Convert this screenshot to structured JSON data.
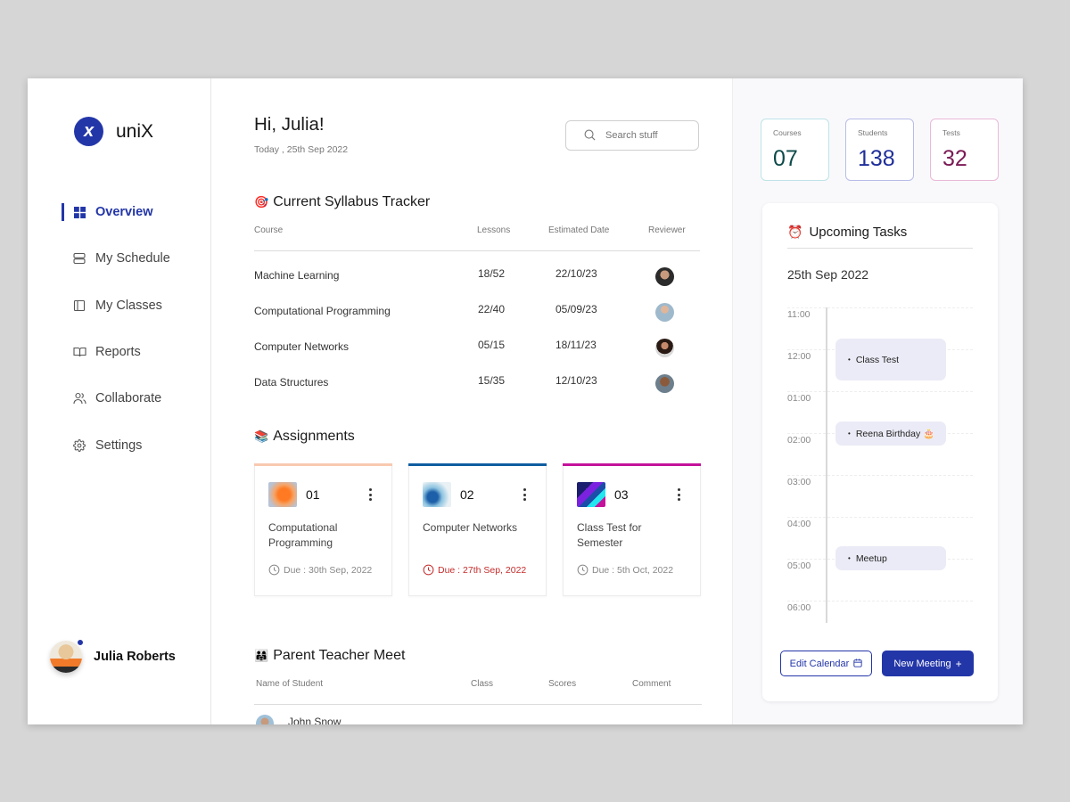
{
  "app": {
    "name": "uniX",
    "logo_glyph": "x"
  },
  "sidebar": {
    "items": [
      {
        "label": "Overview",
        "icon": "grid-icon",
        "active": true
      },
      {
        "label": "My Schedule",
        "icon": "schedule-icon",
        "active": false
      },
      {
        "label": "My Classes",
        "icon": "classes-icon",
        "active": false
      },
      {
        "label": "Reports",
        "icon": "book-icon",
        "active": false
      },
      {
        "label": "Collaborate",
        "icon": "users-icon",
        "active": false
      },
      {
        "label": "Settings",
        "icon": "gear-icon",
        "active": false
      }
    ],
    "user": {
      "name": "Julia Roberts",
      "online": true
    }
  },
  "header": {
    "greeting": "Hi, Julia!",
    "today": "Today , 25th Sep 2022",
    "search": {
      "placeholder": "Search stuff",
      "value": ""
    }
  },
  "syllabus": {
    "emoji": "🎯",
    "title": "Current Syllabus Tracker",
    "columns": [
      "Course",
      "Lessons",
      "Estimated Date",
      "Reviewer"
    ],
    "rows": [
      {
        "course": "Machine Learning",
        "lessons": "18/52",
        "date": "22/10/23"
      },
      {
        "course": "Computational Programming",
        "lessons": "22/40",
        "date": "05/09/23"
      },
      {
        "course": "Computer Networks",
        "lessons": "05/15",
        "date": "18/11/23"
      },
      {
        "course": "Data Structures",
        "lessons": "15/35",
        "date": "12/10/23"
      }
    ]
  },
  "assignments": {
    "emoji": "📚",
    "title": "Assignments",
    "items": [
      {
        "num": "01",
        "title": "Computational Programming",
        "due": "Due :  30th Sep, 2022",
        "overdue": false,
        "accent": "#f8c9b0"
      },
      {
        "num": "02",
        "title": "Computer Networks",
        "due": "Due :  27th Sep, 2022",
        "overdue": true,
        "accent": "#0f5da1"
      },
      {
        "num": "03",
        "title": "Class Test for Semester",
        "due": "Due :  5th Oct, 2022",
        "overdue": false,
        "accent": "#c4129b"
      }
    ]
  },
  "ptm": {
    "emoji": "👨‍👩‍👧",
    "title": "Parent Teacher Meet",
    "columns": [
      "Name of Student",
      "Class",
      "Scores",
      "Comment"
    ],
    "rows": [
      {
        "name": "John Snow"
      }
    ]
  },
  "stats": [
    {
      "label": "Courses",
      "value": "07",
      "color": "#0d4a4a",
      "border": "#bfe3e6"
    },
    {
      "label": "Students",
      "value": "138",
      "color": "#1f2f9a",
      "border": "#b8bde8"
    },
    {
      "label": "Tests",
      "value": "32",
      "color": "#7a1a55",
      "border": "#eab9d8"
    }
  ],
  "tasks": {
    "emoji": "⏰",
    "title": "Upcoming Tasks",
    "date": "25th Sep 2022",
    "times": [
      "11:00",
      "12:00",
      "01:00",
      "02:00",
      "03:00",
      "04:00",
      "05:00",
      "06:00"
    ],
    "events": [
      {
        "label": "Class Test",
        "start": "12:00"
      },
      {
        "label": "Reena Birthday 🎂",
        "start": "02:00"
      },
      {
        "label": "Meetup",
        "start": "05:00"
      }
    ],
    "edit_label": "Edit Calendar",
    "new_label": "New Meeting"
  },
  "colors": {
    "brand": "#2336a8",
    "overdue": "#c52c2c"
  }
}
